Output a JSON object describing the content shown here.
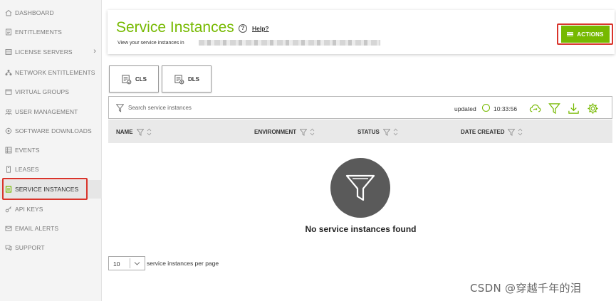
{
  "sidebar": {
    "items": [
      {
        "label": "DASHBOARD",
        "icon": "home-icon"
      },
      {
        "label": "ENTITLEMENTS",
        "icon": "document-icon"
      },
      {
        "label": "LICENSE SERVERS",
        "icon": "server-icon"
      },
      {
        "label": "NETWORK ENTITLEMENTS",
        "icon": "network-icon"
      },
      {
        "label": "VIRTUAL GROUPS",
        "icon": "window-icon"
      },
      {
        "label": "USER MANAGEMENT",
        "icon": "users-icon"
      },
      {
        "label": "SOFTWARE DOWNLOADS",
        "icon": "download-cloud-icon"
      },
      {
        "label": "EVENTS",
        "icon": "events-icon"
      },
      {
        "label": "LEASES",
        "icon": "lease-icon"
      },
      {
        "label": "SERVICE INSTANCES",
        "icon": "service-instance-icon",
        "active": true
      },
      {
        "label": "API KEYS",
        "icon": "key-icon"
      },
      {
        "label": "EMAIL ALERTS",
        "icon": "mail-icon"
      },
      {
        "label": "SUPPORT",
        "icon": "chat-icon"
      }
    ]
  },
  "header": {
    "title": "Service Instances",
    "help_icon": "?",
    "help_label": "Help?",
    "subtitle": "View your service instances in",
    "actions_label": "ACTIONS"
  },
  "tabs": [
    {
      "label": "CLS",
      "icon": "cls-icon"
    },
    {
      "label": "DLS",
      "icon": "dls-icon"
    }
  ],
  "search": {
    "placeholder": "Search service instances",
    "updated_label": "updated",
    "time": "10:33:56"
  },
  "table": {
    "columns": [
      "NAME",
      "ENVIRONMENT",
      "STATUS",
      "DATE CREATED"
    ]
  },
  "empty_state": {
    "message": "No service instances found"
  },
  "pagination": {
    "page_size": "10",
    "label": "service instances per page"
  },
  "watermark": "CSDN @穿越千年的泪",
  "colors": {
    "accent": "#76b900",
    "highlight": "#d9342b"
  }
}
